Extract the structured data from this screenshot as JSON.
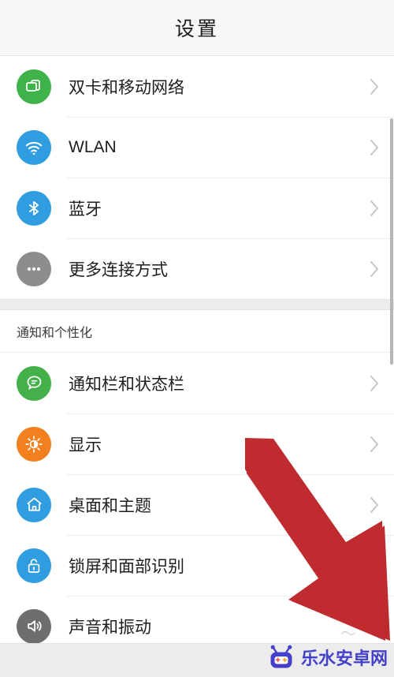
{
  "header": {
    "title": "设置"
  },
  "scrollbar": {
    "name": "vertical-scrollbar"
  },
  "groups": [
    {
      "id": "connectivity",
      "section_title": null,
      "items": [
        {
          "label": "双卡和移动网络",
          "icon": "sim-card-icon",
          "icon_color": "#3fb24a",
          "chevron": "chevron-right-icon"
        },
        {
          "label": "WLAN",
          "icon": "wifi-icon",
          "icon_color": "#2f9de0",
          "chevron": "chevron-right-icon"
        },
        {
          "label": "蓝牙",
          "icon": "bluetooth-icon",
          "icon_color": "#2f9de0",
          "chevron": "chevron-right-icon"
        },
        {
          "label": "更多连接方式",
          "icon": "more-dots-icon",
          "icon_color": "#8d8d8d",
          "chevron": "chevron-right-icon"
        }
      ]
    },
    {
      "id": "notifications-personalization",
      "section_title": "通知和个性化",
      "items": [
        {
          "label": "通知栏和状态栏",
          "icon": "chat-bubble-icon",
          "icon_color": "#43b049",
          "chevron": "chevron-right-icon"
        },
        {
          "label": "显示",
          "icon": "brightness-icon",
          "icon_color": "#f3801f",
          "chevron": "chevron-right-icon"
        },
        {
          "label": "桌面和主题",
          "icon": "home-icon",
          "icon_color": "#2f9de0",
          "chevron": "chevron-right-icon"
        },
        {
          "label": "锁屏和面部识别",
          "icon": "lock-open-icon",
          "icon_color": "#2f9de0",
          "chevron": "chevron-right-icon"
        },
        {
          "label": "声音和振动",
          "icon": "speaker-icon",
          "icon_color": "#6e6e6e",
          "chevron": "chevron-right-icon"
        }
      ]
    }
  ],
  "annotation": {
    "name": "red-arrow-annotation",
    "color": "#be2b2e",
    "direction": "down-right"
  },
  "watermark": {
    "text": "乐水安卓网",
    "logo": "robot-icon",
    "logo_color": "#4540c9",
    "text_color": "#4540c9"
  }
}
